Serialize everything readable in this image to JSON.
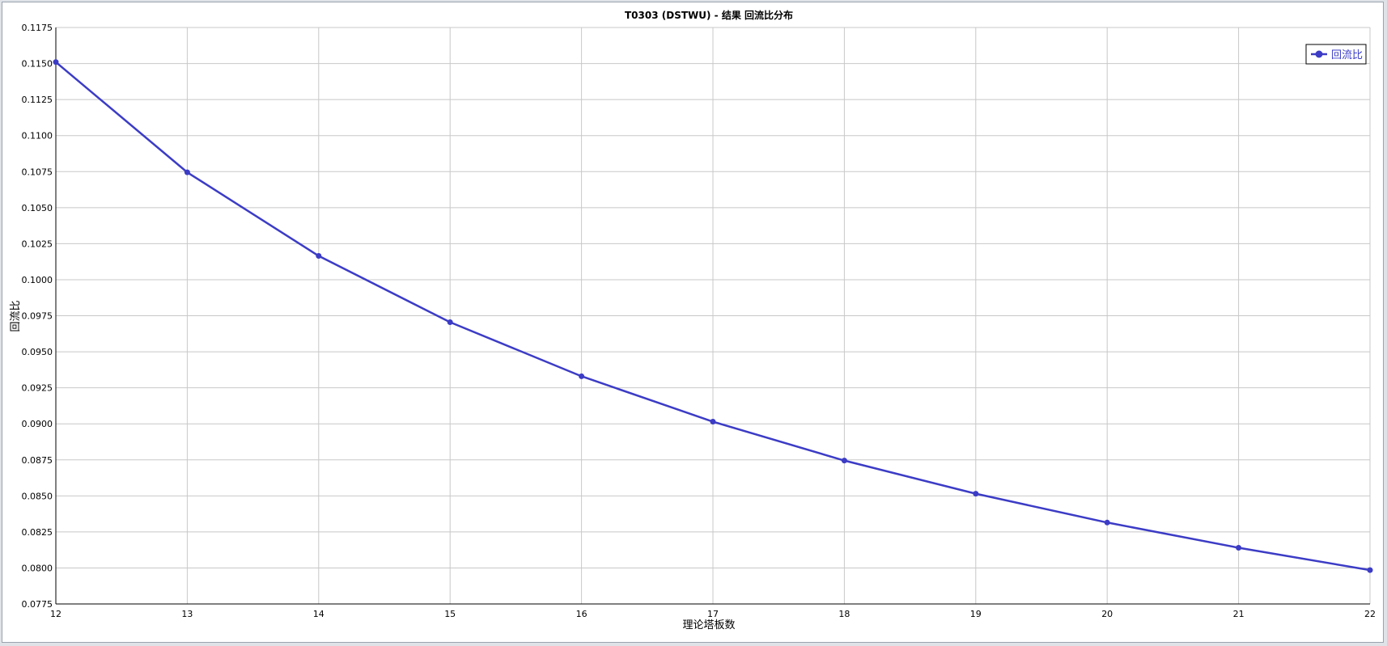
{
  "colors": {
    "series": "#3c3cc6",
    "grid": "#c8c8c8",
    "axis": "#000000",
    "background": "#ffffff"
  },
  "chart_data": {
    "type": "line",
    "title": "T0303 (DSTWU) - 结果 回流比分布",
    "xlabel": "理论塔板数",
    "ylabel": "回流比",
    "xlim": [
      12,
      22
    ],
    "ylim": [
      0.0775,
      0.1175
    ],
    "x_ticks": [
      "12",
      "13",
      "14",
      "15",
      "16",
      "17",
      "18",
      "19",
      "20",
      "21",
      "22"
    ],
    "y_ticks": [
      "0.0775",
      "0.0800",
      "0.0825",
      "0.0850",
      "0.0875",
      "0.0900",
      "0.0925",
      "0.0950",
      "0.0975",
      "0.1000",
      "0.1025",
      "0.1050",
      "0.1075",
      "0.1100",
      "0.1125",
      "0.1150",
      "0.1175"
    ],
    "grid": true,
    "legend_position": "top-right",
    "series": [
      {
        "name": "回流比",
        "x": [
          12,
          13,
          14,
          15,
          16,
          17,
          18,
          19,
          20,
          21,
          22
        ],
        "values": [
          0.1151,
          0.10745,
          0.10165,
          0.09705,
          0.0933,
          0.09015,
          0.08745,
          0.08515,
          0.08315,
          0.0814,
          0.07985
        ]
      }
    ]
  }
}
